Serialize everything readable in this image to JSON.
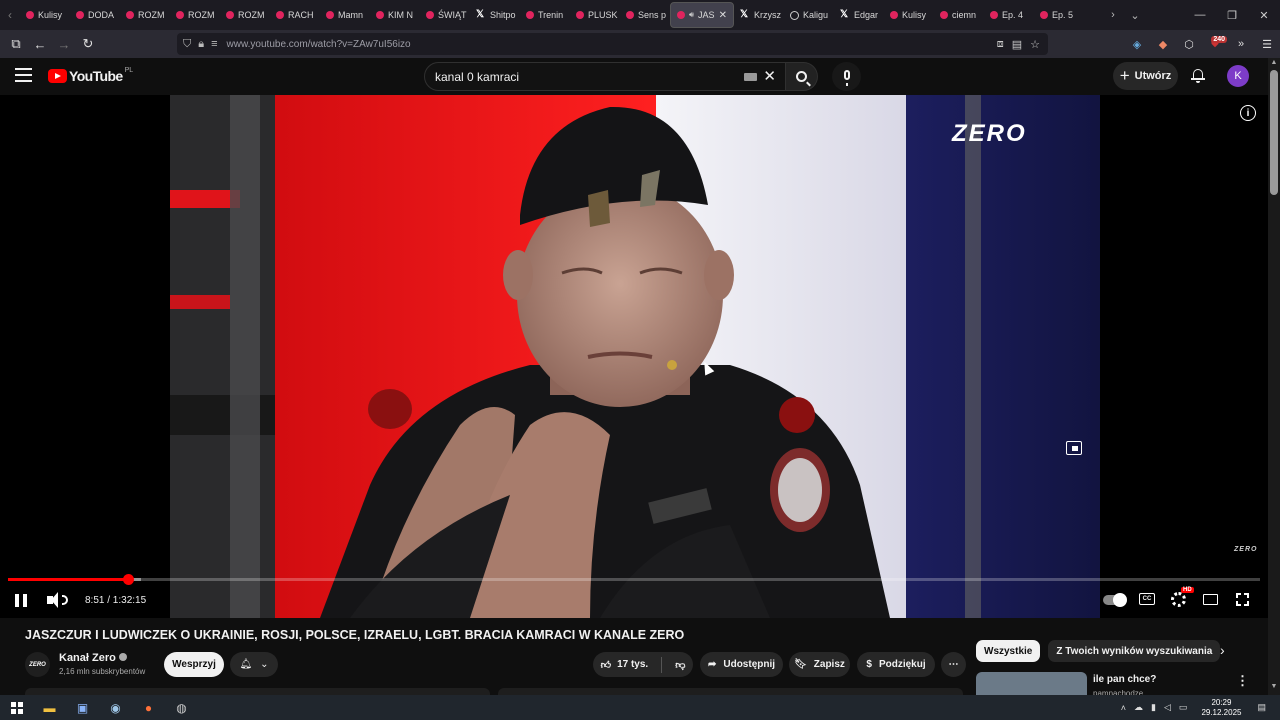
{
  "browser": {
    "tabs": [
      {
        "label": "Kulisy",
        "fav": "yt"
      },
      {
        "label": "DODA",
        "fav": "yt"
      },
      {
        "label": "ROZM",
        "fav": "yt"
      },
      {
        "label": "ROZM",
        "fav": "yt"
      },
      {
        "label": "ROZM",
        "fav": "yt"
      },
      {
        "label": "RACH",
        "fav": "yt"
      },
      {
        "label": "Mamn",
        "fav": "yt"
      },
      {
        "label": "KIM N",
        "fav": "yt"
      },
      {
        "label": "ŚWIĄT",
        "fav": "yt"
      },
      {
        "label": "Shitpo",
        "fav": "x"
      },
      {
        "label": "Trenin",
        "fav": "yt"
      },
      {
        "label": "PLUSK",
        "fav": "yt"
      },
      {
        "label": "Sens p",
        "fav": "yt"
      },
      {
        "label": "JAS",
        "fav": "yt",
        "active": true
      },
      {
        "label": "Krzysz",
        "fav": "x"
      },
      {
        "label": "Kaligu",
        "fav": "circ"
      },
      {
        "label": "Edgar",
        "fav": "x"
      },
      {
        "label": "Kulisy",
        "fav": "yt"
      },
      {
        "label": "ciemn",
        "fav": "yt"
      },
      {
        "label": "Ep. 4",
        "fav": "yt"
      },
      {
        "label": "Ep. 5",
        "fav": "yt"
      }
    ],
    "url": "www.youtube.com/watch?v=ZAw7uI56izo",
    "extension_badge": "240"
  },
  "youtube": {
    "logo_text": "YouTube",
    "country": "PL",
    "search_value": "kanal 0 kamraci",
    "create_label": "Utwórz",
    "avatar_letter": "K"
  },
  "player": {
    "watermark": "ZERO",
    "watermark_small": "ZERO",
    "time_current": "8:51",
    "time_total": "1:32:15",
    "time_display": "8:51 / 1:32:15",
    "progress": 0.096,
    "buffered": 0.106,
    "cc_label": "CC",
    "quality_badge": "HD"
  },
  "video": {
    "title": "JASZCZUR I LUDWICZEK O UKRAINIE, ROSJI, POLSCE, IZRAELU, LGBT. BRACIA KAMRACI W KANALE ZERO",
    "channel_name": "Kanał Zero",
    "channel_avatar_text": "ZERO",
    "subscribers": "2,16 mln subskrybentów",
    "support_label": "Wesprzyj",
    "likes": "17 tys.",
    "share_label": "Udostępnij",
    "save_label": "Zapisz",
    "thanks_label": "Podziękuj"
  },
  "sidebar": {
    "chips": [
      "Wszystkie",
      "Z Twoich wyników wyszukiwania"
    ],
    "rec_title": "ile pan chce?",
    "rec_channel": "pamnachodzę"
  },
  "taskbar": {
    "time": "20:29",
    "date": "29.12.2025"
  },
  "colors": {
    "youtube_red": "#ff0000",
    "background": "#0f0f0f"
  }
}
